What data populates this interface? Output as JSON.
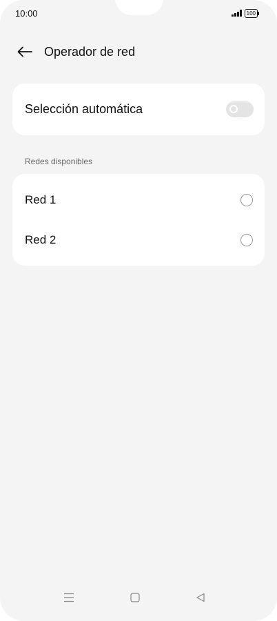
{
  "status_bar": {
    "time": "10:00",
    "battery_level": "100"
  },
  "header": {
    "back_icon": "arrow-left-icon",
    "title": "Operador de red"
  },
  "auto_selection": {
    "label": "Selección automática",
    "toggle_on": false
  },
  "networks": {
    "section_title": "Redes disponibles",
    "items": [
      {
        "label": "Red 1",
        "selected": false
      },
      {
        "label": "Red 2",
        "selected": false
      }
    ]
  },
  "nav_bar": {
    "icons": [
      "menu-icon",
      "home-square-icon",
      "back-triangle-icon"
    ]
  },
  "colors": {
    "background": "#f4f4f4",
    "card": "#ffffff",
    "toggle_off": "#e4e4e4",
    "text": "#111111",
    "secondary_text": "#666666"
  }
}
